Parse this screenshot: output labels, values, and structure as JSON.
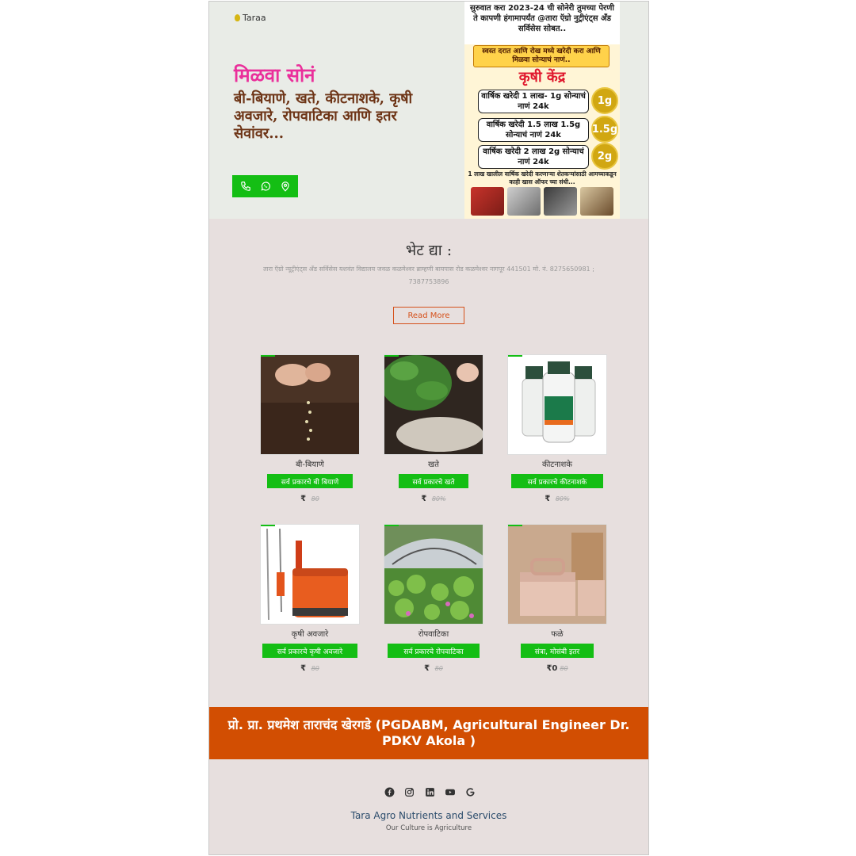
{
  "brand": {
    "logo_text": "Taraa"
  },
  "hero": {
    "headline": "मिळवा सोनं",
    "subheadline": "बी-बियाणे, खते, कीटनाशके, कृषी अवजारे, रोपवाटिका आणि इतर सेवांवर...",
    "contact_icons": [
      "phone-icon",
      "whatsapp-icon",
      "location-pin-icon"
    ]
  },
  "poster": {
    "top_text": "सुरुवात करा 2023-24 ची सोनेरी तुमच्या पेरणी ते कापणी हंगामापर्यंत @तारा ऍग्रो नुट्रीएंट्स अँड सर्विसेस सोबत..",
    "banner": "स्वस्त दरात आणि रोख मध्ये खरेदी करा आणि मिळवा सोन्याचं नाणं..",
    "title": "कृषी केंद्र",
    "offers": [
      {
        "text": "वार्षिक खरेदी 1 लाख- 1g सोन्याचं नाणं 24k",
        "coin": "1g"
      },
      {
        "text": "वार्षिक खरेदी 1.5 लाख 1.5g सोन्याचं नाणं 24k",
        "coin": "1.5g"
      },
      {
        "text": "वार्षिक खरेदी 2 लाख 2g सोन्याचं नाणं 24k",
        "coin": "2g"
      }
    ],
    "note": "1 लाख खालील वार्षिक खरेदी करणाऱ्या शेतकऱ्यांसाठी आमच्याकडून काही खास ऑफर च्या संधी..."
  },
  "visit": {
    "title": "भेट द्या :",
    "address": "तारा ऍग्रो न्यूट्रीएंट्स अँड सर्विसेस यशवंत विद्यालय जवळ कळमेश्वर ब्राम्हणी बायपास रोड कळमेश्वर नागपूर 441501 मो. नं. 8275650981 ; 7387753896",
    "read_more": "Read More"
  },
  "products": [
    {
      "name": "बी-बियाणे",
      "tag": "सर्व प्रकारचे बी बियाणे",
      "currency": "₹",
      "price": "",
      "old_price": "80"
    },
    {
      "name": "खते",
      "tag": "सर्व प्रकारचे खते",
      "currency": "₹",
      "price": "",
      "old_price": "80%"
    },
    {
      "name": "कीटनाशके",
      "tag": "सर्व प्रकारचे कीटनाशके",
      "currency": "₹",
      "price": "",
      "old_price": "80%"
    },
    {
      "name": "कृषी अवजारे",
      "tag": "सर्व प्रकारचे कृषी अवजारे",
      "currency": "₹",
      "price": "",
      "old_price": "80"
    },
    {
      "name": "रोपवाटिका",
      "tag": "सर्व प्रकारचे रोपवाटिका",
      "currency": "₹",
      "price": "",
      "old_price": "80"
    },
    {
      "name": "फळे",
      "tag": "संत्रा, मोसंबी इतर",
      "currency": "₹",
      "price": "0",
      "old_price": "80"
    }
  ],
  "footer": {
    "proprietor": "प्रो. प्रा. प्रथमेश ताराचंद खेरगडे (PGDABM, Agricultural Engineer Dr. PDKV Akola )",
    "social_icons": [
      "facebook-icon",
      "instagram-icon",
      "linkedin-icon",
      "youtube-icon",
      "google-icon"
    ],
    "company": "Tara Agro Nutrients and Services",
    "tagline": "Our Culture is Agriculture"
  },
  "colors": {
    "green": "#14be14",
    "orange": "#d24e02",
    "pink": "#ea2f9b",
    "brown": "#6d3416"
  }
}
